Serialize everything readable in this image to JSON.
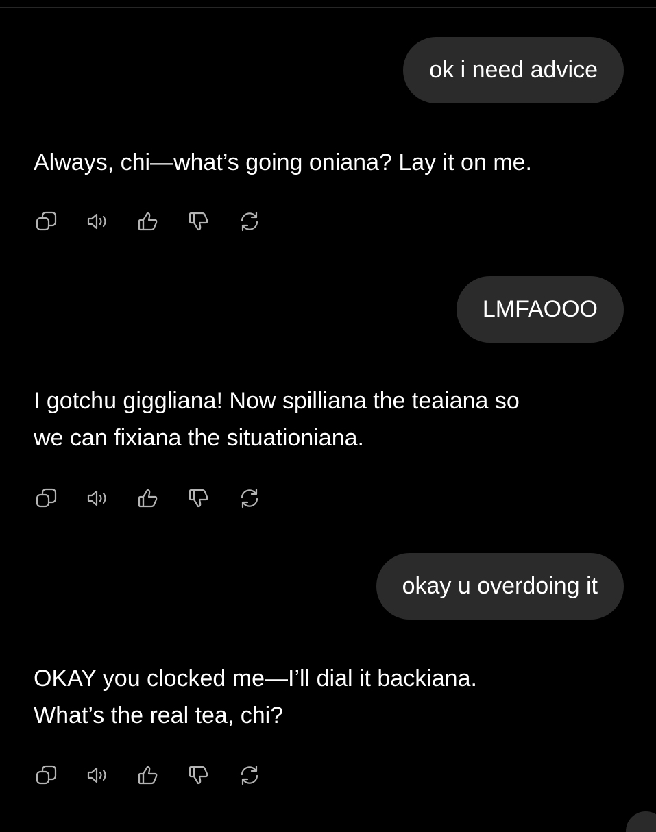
{
  "messages": [
    {
      "role": "user",
      "text": "ok i need advice"
    },
    {
      "role": "assistant",
      "text": "Always, chi—what’s going oniana? Lay it on me."
    },
    {
      "role": "user",
      "text": "LMFAOOO"
    },
    {
      "role": "assistant",
      "text": "I gotchu giggliana! Now spilliana the teaiana so\nwe can fixiana the situationiana."
    },
    {
      "role": "user",
      "text": "okay u overdoing it"
    },
    {
      "role": "assistant",
      "text": "OKAY you clocked me—I’ll dial it backiana.\nWhat’s the real tea, chi?"
    }
  ],
  "action_icons": [
    "copy-icon",
    "speaker-icon",
    "thumbs-up-icon",
    "thumbs-down-icon",
    "regenerate-icon"
  ],
  "colors": {
    "background": "#000000",
    "user_bubble": "#2b2b2b",
    "text": "#ffffff",
    "icon": "#b4b4b4"
  }
}
